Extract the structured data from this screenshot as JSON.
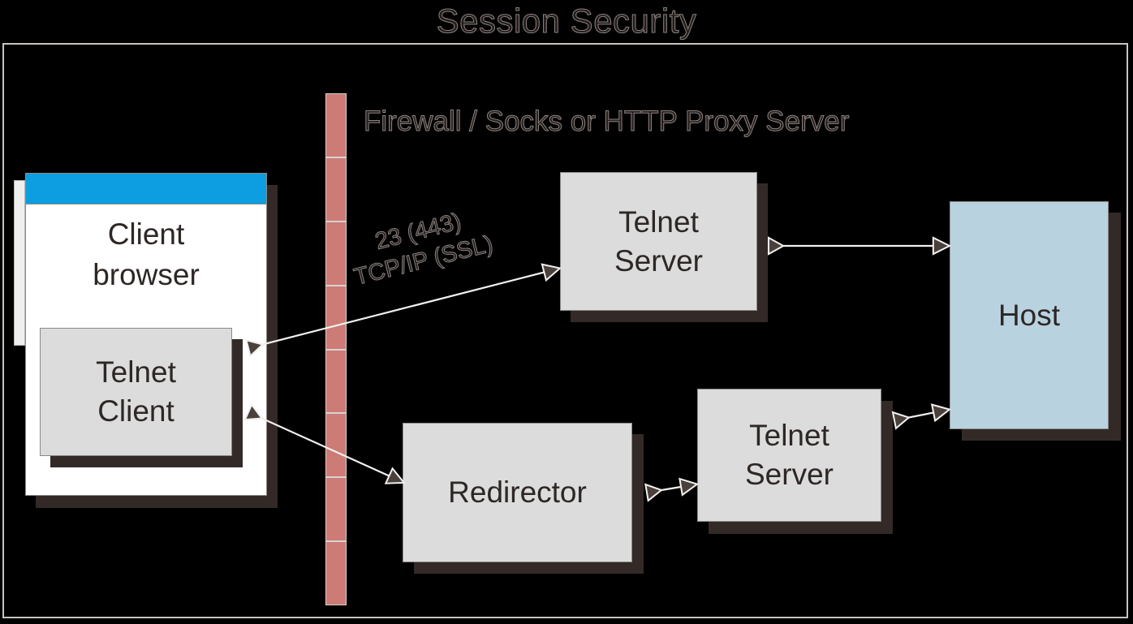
{
  "title": "Session Security",
  "firewall": {
    "label": "Firewall / Socks or HTTP Proxy Server",
    "brick_count": 8,
    "color": "#cc7b77"
  },
  "nodes": {
    "client_browser": {
      "label": "Client browser",
      "line1": "Client",
      "line2": "browser",
      "titlebar_color": "#0c9ee0",
      "body_color": "#ffffff"
    },
    "telnet_client": {
      "label": "Telnet Client",
      "line1": "Telnet",
      "line2": "Client",
      "color": "#dcdcdc"
    },
    "telnet_server_top": {
      "label": "Telnet Server",
      "line1": "Telnet",
      "line2": "Server",
      "color": "#dcdcdc"
    },
    "telnet_server_bottom": {
      "label": "Telnet Server",
      "line1": "Telnet",
      "line2": "Server",
      "color": "#dcdcdc"
    },
    "redirector": {
      "label": "Redirector",
      "color": "#dcdcdc"
    },
    "host": {
      "label": "Host",
      "color": "#b9d2e0"
    }
  },
  "connections": {
    "client_to_server_port": "23 (443)",
    "client_to_server_protocol": "TCP/IP (SSL)"
  },
  "colors": {
    "background": "#000000",
    "shadow": "#332a27",
    "outline": "#8d8a88",
    "text": "#2d2725",
    "arrow": "#f2f0ee"
  }
}
